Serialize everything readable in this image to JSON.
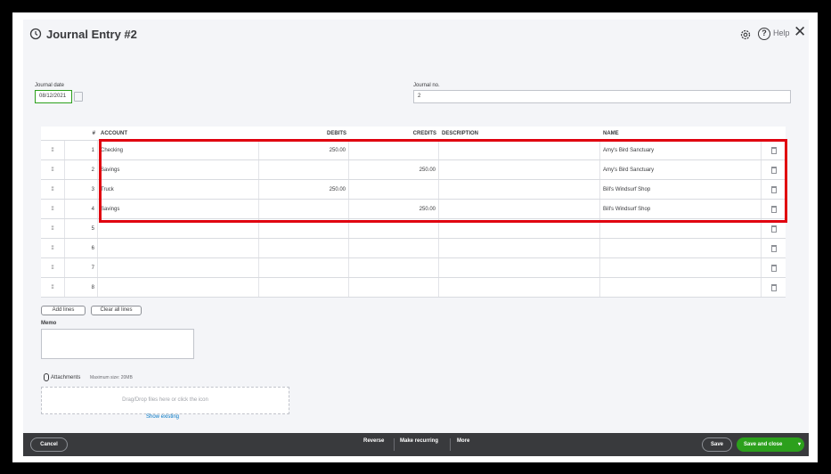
{
  "header": {
    "title": "Journal Entry #2",
    "help_label": "Help",
    "close_glyph": "✕"
  },
  "form": {
    "date_label": "Journal date",
    "date_value": "08/12/2021",
    "journal_no_label": "Journal no.",
    "journal_no_value": "2"
  },
  "table": {
    "headers": {
      "num": "#",
      "account": "ACCOUNT",
      "debits": "DEBITS",
      "credits": "CREDITS",
      "description": "DESCRIPTION",
      "name": "NAME"
    },
    "rows": [
      {
        "num": "1",
        "account": "Checking",
        "debits": "250.00",
        "credits": "",
        "description": "",
        "name": "Amy's Bird Sanctuary"
      },
      {
        "num": "2",
        "account": "Savings",
        "debits": "",
        "credits": "250.00",
        "description": "",
        "name": "Amy's Bird Sanctuary"
      },
      {
        "num": "3",
        "account": "Truck",
        "debits": "250.00",
        "credits": "",
        "description": "",
        "name": "Bill's Windsurf Shop"
      },
      {
        "num": "4",
        "account": "Savings",
        "debits": "",
        "credits": "250.00",
        "description": "",
        "name": "Bill's Windsurf Shop"
      },
      {
        "num": "5",
        "account": "",
        "debits": "",
        "credits": "",
        "description": "",
        "name": ""
      },
      {
        "num": "6",
        "account": "",
        "debits": "",
        "credits": "",
        "description": "",
        "name": ""
      },
      {
        "num": "7",
        "account": "",
        "debits": "",
        "credits": "",
        "description": "",
        "name": ""
      },
      {
        "num": "8",
        "account": "",
        "debits": "",
        "credits": "",
        "description": "",
        "name": ""
      }
    ]
  },
  "actions": {
    "add_lines": "Add lines",
    "clear_all_lines": "Clear all lines"
  },
  "memo": {
    "label": "Memo"
  },
  "attachments": {
    "label": "Attachments",
    "max_size": "Maximum size: 20MB",
    "drop_text": "Drag/Drop files here or click the icon",
    "show_existing": "Show existing"
  },
  "footer": {
    "cancel": "Cancel",
    "reverse": "Reverse",
    "make_recurring": "Make recurring",
    "more": "More",
    "save": "Save",
    "save_and_close": "Save and close",
    "caret": "▾"
  },
  "colors": {
    "accent": "#2ca01c",
    "highlight": "#e0000f",
    "footer_bg": "#393a3d",
    "link": "#0077c5"
  }
}
